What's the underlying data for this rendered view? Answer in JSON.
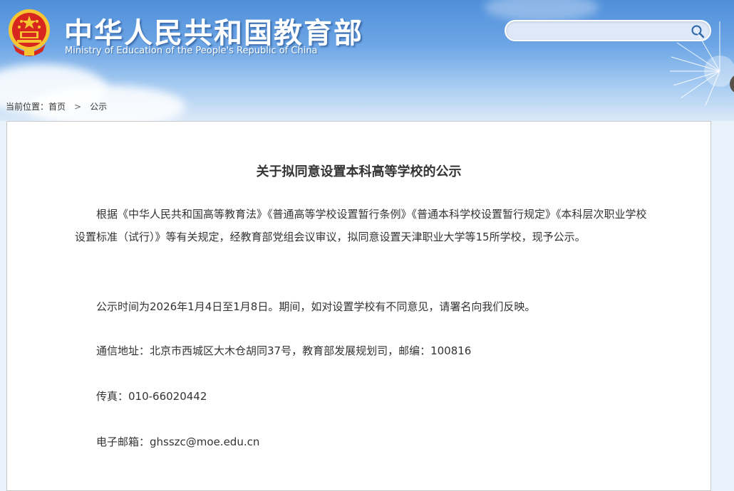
{
  "header": {
    "title_cn": "中华人民共和国教育部",
    "title_en": "Ministry of Education of the People's Republic of China",
    "emblem_icon": "national-emblem-icon",
    "search": {
      "placeholder": "",
      "icon": "search-icon"
    }
  },
  "breadcrumb": {
    "prefix": "当前位置：",
    "home": "首页",
    "separator": ">",
    "current": "公示"
  },
  "article": {
    "title": "关于拟同意设置本科高等学校的公示",
    "paragraphs": [
      "根据《中华人民共和国高等教育法》《普通高等学校设置暂行条例》《普通本科学校设置暂行规定》《本科层次职业学校设置标准（试行）》等有关规定，经教育部党组会议审议，拟同意设置天津职业大学等15所学校，现予公示。",
      "公示时间为2026年1月4日至1月8日。期间，如对设置学校有不同意见，请署名向我们反映。",
      "通信地址：北京市西城区大木仓胡同37号，教育部发展规划司，邮编：100816",
      "传真：010-66020442",
      "电子邮箱：ghsszc@moe.edu.cn"
    ]
  },
  "colors": {
    "header_blue": "#4f8fd9",
    "text": "#333333",
    "emblem_red": "#d7261e",
    "emblem_gold": "#f6c531"
  }
}
